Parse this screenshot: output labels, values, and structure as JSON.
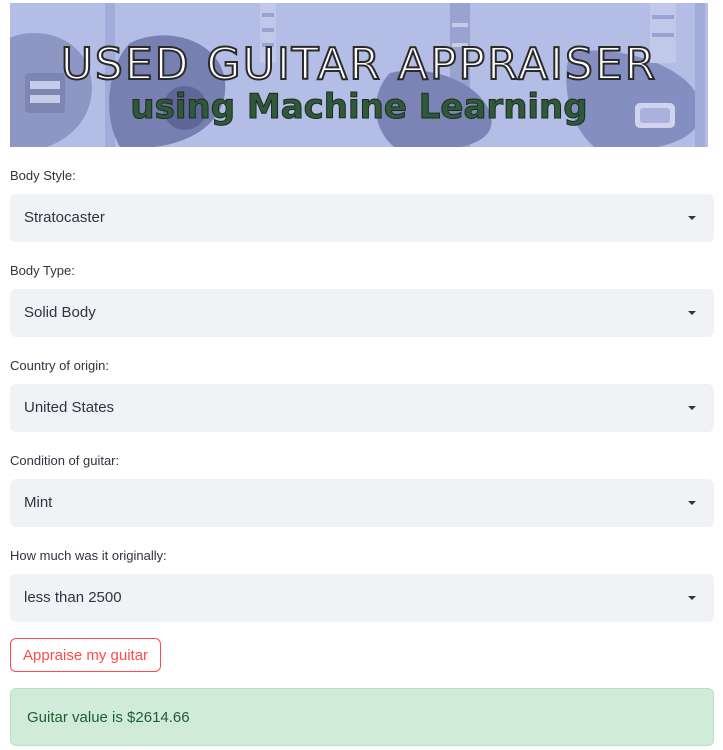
{
  "banner": {
    "title": "USED GUITAR APPRAISER",
    "subtitle": "using Machine Learning"
  },
  "fields": [
    {
      "label": "Body Style:",
      "value": "Stratocaster"
    },
    {
      "label": "Body Type:",
      "value": "Solid Body"
    },
    {
      "label": "Country of origin:",
      "value": "United States"
    },
    {
      "label": "Condition of guitar:",
      "value": "Mint"
    },
    {
      "label": "How much was it originally:",
      "value": "less than 2500"
    }
  ],
  "actions": {
    "appraise_label": "Appraise my guitar"
  },
  "result": {
    "text": "Guitar value is $2614.66"
  },
  "colors": {
    "primary": "#ff4b4b",
    "success_bg": "#d0ecd8",
    "success_text": "#1d5e34",
    "select_bg": "#f0f2f6",
    "banner_bg": "#b4bde6"
  },
  "icons": {
    "dropdown": "caret-down-icon"
  }
}
